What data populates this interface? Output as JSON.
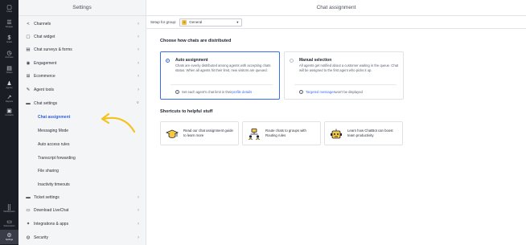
{
  "nav": [
    {
      "icon": "chats-icon",
      "glyph": "▢",
      "label": "Chats"
    },
    {
      "icon": "engage-icon",
      "glyph": "☰",
      "label": "Engage"
    },
    {
      "icon": "goals-icon",
      "glyph": "$",
      "label": "Goals"
    },
    {
      "icon": "archives-icon",
      "glyph": "◷",
      "label": "Archives"
    },
    {
      "icon": "tickets-icon",
      "glyph": "▤",
      "label": "Tickets"
    },
    {
      "icon": "agents-icon",
      "glyph": "♟",
      "label": "Agents"
    },
    {
      "icon": "reports-icon",
      "glyph": "↗",
      "label": "Reports"
    },
    {
      "icon": "contacts-icon",
      "glyph": "▣",
      "label": "Contacts"
    },
    {
      "icon": "marketplace-icon",
      "glyph": "⣿",
      "label": "Marketplace"
    },
    {
      "icon": "subscription-icon",
      "glyph": "▭",
      "label": "Subscription"
    },
    {
      "icon": "settings-icon",
      "glyph": "⚙",
      "label": "Settings"
    }
  ],
  "settings": {
    "title": "Settings",
    "menu_top": [
      {
        "icon": "share-icon",
        "glyph": "<",
        "label": "Channels"
      },
      {
        "icon": "chat-widget-icon",
        "glyph": "▢",
        "label": "Chat widget"
      },
      {
        "icon": "surveys-icon",
        "glyph": "▤",
        "label": "Chat surveys & forms"
      },
      {
        "icon": "eye-icon",
        "glyph": "◉",
        "label": "Engagement"
      },
      {
        "icon": "cart-icon",
        "glyph": "⊞",
        "label": "Ecommerce"
      },
      {
        "icon": "tools-icon",
        "glyph": "✎",
        "label": "Agent tools"
      },
      {
        "icon": "chat-settings-icon",
        "glyph": "▬",
        "label": "Chat settings"
      }
    ],
    "submenu": [
      "Chat assignment",
      "Messaging Mode",
      "Auto access rules",
      "Transcript forwarding",
      "File sharing",
      "Inactivity timeouts"
    ],
    "menu_bottom": [
      {
        "icon": "ticket-icon",
        "glyph": "▬",
        "label": "Ticket settings"
      },
      {
        "icon": "download-icon",
        "glyph": "▭",
        "label": "Download LiveChat"
      },
      {
        "icon": "integrations-icon",
        "glyph": "✦",
        "label": "Integrations & apps"
      },
      {
        "icon": "shield-icon",
        "glyph": "◍",
        "label": "Security"
      }
    ]
  },
  "main": {
    "title": "Chat assignment",
    "group_label": "Setup for group:",
    "group_badge": "G",
    "group_value": "General",
    "distribution_heading": "Choose how chats are distributed",
    "auto": {
      "title": "Auto assignment",
      "desc": "Chats are evenly distributed among agents with accepting chats status. When all agents hit their limit, new visitors are queued.",
      "foot_prefix": "Set each agent's chat limit in their ",
      "foot_link": "profile details"
    },
    "manual": {
      "title": "Manual selection",
      "desc": "All agents get notified about a customer waiting in the queue. Chat will be assigned to the first agent who picks it up.",
      "foot_link": "Targeted messages",
      "foot_suffix": " won't be displayed"
    },
    "shortcuts_heading": "Shortcuts to helpful stuff",
    "shortcuts": [
      {
        "icon": "graduation-cap-icon",
        "text": "Read our chat assignment guide to learn more"
      },
      {
        "icon": "routing-icon",
        "text": "Route chats to groups with Routing rules"
      },
      {
        "icon": "robot-icon",
        "text": "Learn how ChatBot can boost team productivity"
      }
    ]
  },
  "colors": {
    "accent": "#3b6cf0",
    "nav_bg": "#1b1d24",
    "arrow": "#f4c21a"
  }
}
